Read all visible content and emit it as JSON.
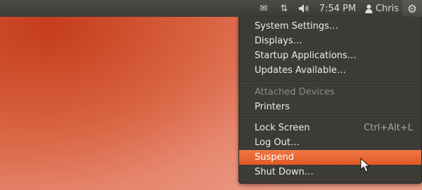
{
  "panel": {
    "clock": "7:54 PM",
    "user_name": "Chris",
    "icons": {
      "mail": "envelope-icon",
      "network": "network-arrows-icon",
      "sound": "speaker-icon",
      "user": "person-icon",
      "session": "gear-icon"
    },
    "glyphs": {
      "mail": "✉",
      "network": "⇅",
      "sound": "🔊",
      "user": "👤",
      "session": "⚙"
    }
  },
  "menu": {
    "system_settings": "System Settings…",
    "displays": "Displays…",
    "startup_applications": "Startup Applications…",
    "updates_available": "Updates Available…",
    "attached_devices_header": "Attached Devices",
    "printers": "Printers",
    "lock_screen": "Lock Screen",
    "lock_screen_shortcut": "Ctrl+Alt+L",
    "log_out": "Log Out…",
    "suspend": "Suspend",
    "shut_down": "Shut Down…"
  },
  "colors": {
    "panel_bg": "#3c3b37",
    "menu_bg": "#3c3b37",
    "highlight": "#e9652d",
    "desktop_accent": "#d2553a"
  }
}
